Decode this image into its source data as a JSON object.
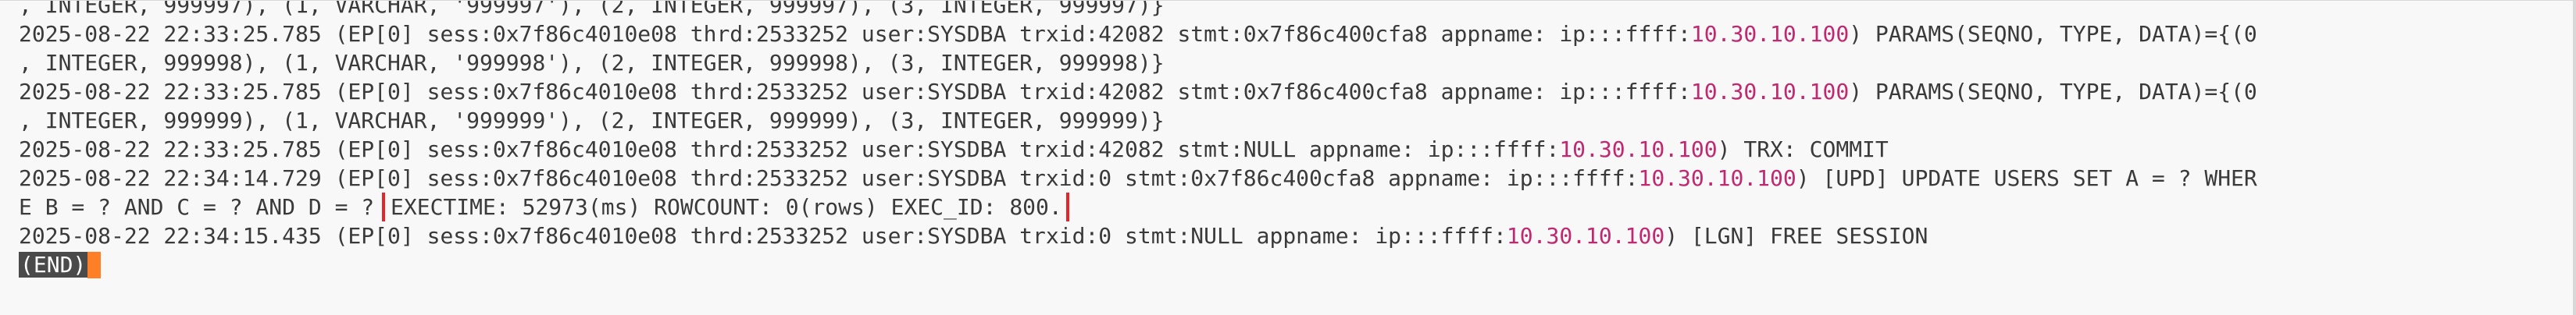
{
  "terminal": {
    "lines": [
      {
        "segments": [
          {
            "t": ", INTEGER, 999997), (1, VARCHAR, '999997'), (2, INTEGER, 999997), (3, INTEGER, 999997)}"
          }
        ]
      },
      {
        "segments": [
          {
            "t": "2025-08-22 22:33:25.785 (EP[0] sess:0x7f86c4010e08 thrd:2533252 user:SYSDBA trxid:42082 stmt:0x7f86c400cfa8 appname: ip:::ffff:"
          },
          {
            "t": "10.30.10.100",
            "c": "ip"
          },
          {
            "t": ") PARAMS(SEQNO, TYPE, DATA)={(0"
          }
        ]
      },
      {
        "segments": [
          {
            "t": ", INTEGER, 999998), (1, VARCHAR, '999998'), (2, INTEGER, 999998), (3, INTEGER, 999998)}"
          }
        ]
      },
      {
        "segments": [
          {
            "t": "2025-08-22 22:33:25.785 (EP[0] sess:0x7f86c4010e08 thrd:2533252 user:SYSDBA trxid:42082 stmt:0x7f86c400cfa8 appname: ip:::ffff:"
          },
          {
            "t": "10.30.10.100",
            "c": "ip"
          },
          {
            "t": ") PARAMS(SEQNO, TYPE, DATA)={(0"
          }
        ]
      },
      {
        "segments": [
          {
            "t": ", INTEGER, 999999), (1, VARCHAR, '999999'), (2, INTEGER, 999999), (3, INTEGER, 999999)}"
          }
        ]
      },
      {
        "segments": [
          {
            "t": "2025-08-22 22:33:25.785 (EP[0] sess:0x7f86c4010e08 thrd:2533252 user:SYSDBA trxid:42082 stmt:NULL appname: ip:::ffff:"
          },
          {
            "t": "10.30.10.100",
            "c": "ip"
          },
          {
            "t": ") TRX: COMMIT"
          }
        ]
      },
      {
        "segments": [
          {
            "t": "2025-08-22 22:34:14.729 (EP[0] sess:0x7f86c4010e08 thrd:2533252 user:SYSDBA trxid:0 stmt:0x7f86c400cfa8 appname: ip:::ffff:"
          },
          {
            "t": "10.30.10.100",
            "c": "ip"
          },
          {
            "t": ") [UPD] UPDATE USERS SET A = ? WHER"
          }
        ]
      },
      {
        "segments": [
          {
            "t": "E B = ? AND C = ? AND D = ? "
          },
          {
            "t": "EXECTIME: 52973(ms) ROWCOUNT: 0(rows) EXEC_ID: 800.",
            "c": "highlight"
          }
        ]
      },
      {
        "segments": [
          {
            "t": "2025-08-22 22:34:15.435 (EP[0] sess:0x7f86c4010e08 thrd:2533252 user:SYSDBA trxid:0 stmt:NULL appname: ip:::ffff:"
          },
          {
            "t": "10.30.10.100",
            "c": "ip"
          },
          {
            "t": ") [LGN] FREE SESSION"
          }
        ]
      }
    ],
    "end_marker": "(END)",
    "colors": {
      "background": "#f8f8f8",
      "text": "#3a3a3a",
      "ip_address": "#c02870",
      "highlight_box": "#e3262b",
      "cursor": "#ff7f27",
      "end_marker_bg": "#4a4a4a"
    }
  }
}
